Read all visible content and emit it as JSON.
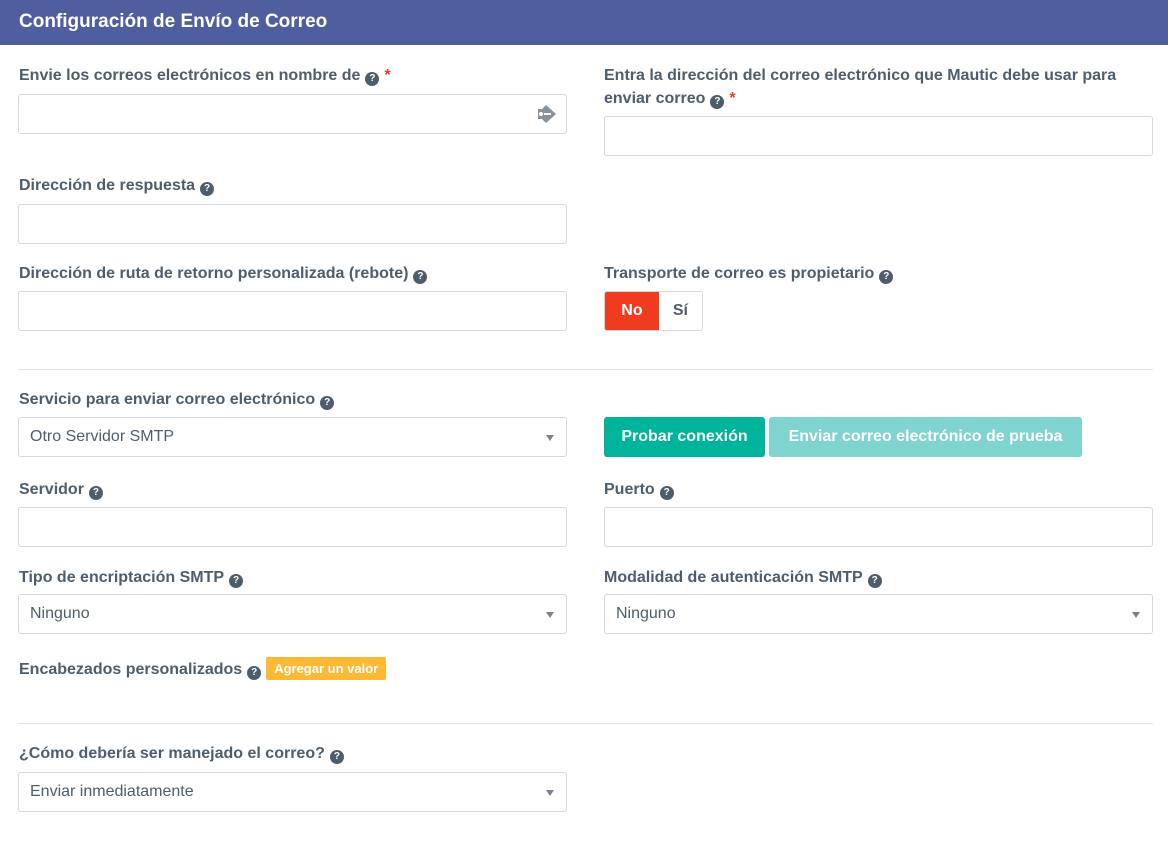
{
  "header": {
    "title": "Configuración de Envío de Correo"
  },
  "form": {
    "from_name": {
      "label": "Envie los correos electrónicos en nombre de",
      "required": "*",
      "value": ""
    },
    "from_email": {
      "label": "Entra la dirección del correo electrónico que Mautic debe usar para enviar correo",
      "required": "*",
      "value": ""
    },
    "reply_to": {
      "label": "Dirección de respuesta",
      "value": ""
    },
    "return_path": {
      "label": "Dirección de ruta de retorno personalizada (rebote)",
      "value": ""
    },
    "transport_owner": {
      "label": "Transporte de correo es propietario",
      "options": [
        "No",
        "Sí"
      ],
      "selected": "No"
    },
    "transport": {
      "label": "Servicio para enviar correo electrónico",
      "value": "Otro Servidor SMTP"
    },
    "test_connection_button": "Probar conexión",
    "send_test_button": "Enviar correo electrónico de prueba",
    "host": {
      "label": "Servidor",
      "value": ""
    },
    "port": {
      "label": "Puerto",
      "value": ""
    },
    "encryption": {
      "label": "Tipo de encriptación SMTP",
      "value": "Ninguno"
    },
    "auth_mode": {
      "label": "Modalidad de autenticación SMTP",
      "value": "Ninguno"
    },
    "custom_headers": {
      "label": "Encabezados personalizados",
      "add_button": "Agregar un valor"
    },
    "spool": {
      "label": "¿Cómo debería ser manejado el correo?",
      "value": "Enviar inmediatamente"
    }
  },
  "icons": {
    "help": "question-circle-icon",
    "autofill": "autofill-key-icon",
    "caret": "caret-down-icon"
  },
  "colors": {
    "header": "#4e5e9e",
    "danger": "#f03b1f",
    "primary": "#00b49c",
    "primary_disabled": "#7fd4d0",
    "warning": "#fdb933"
  }
}
